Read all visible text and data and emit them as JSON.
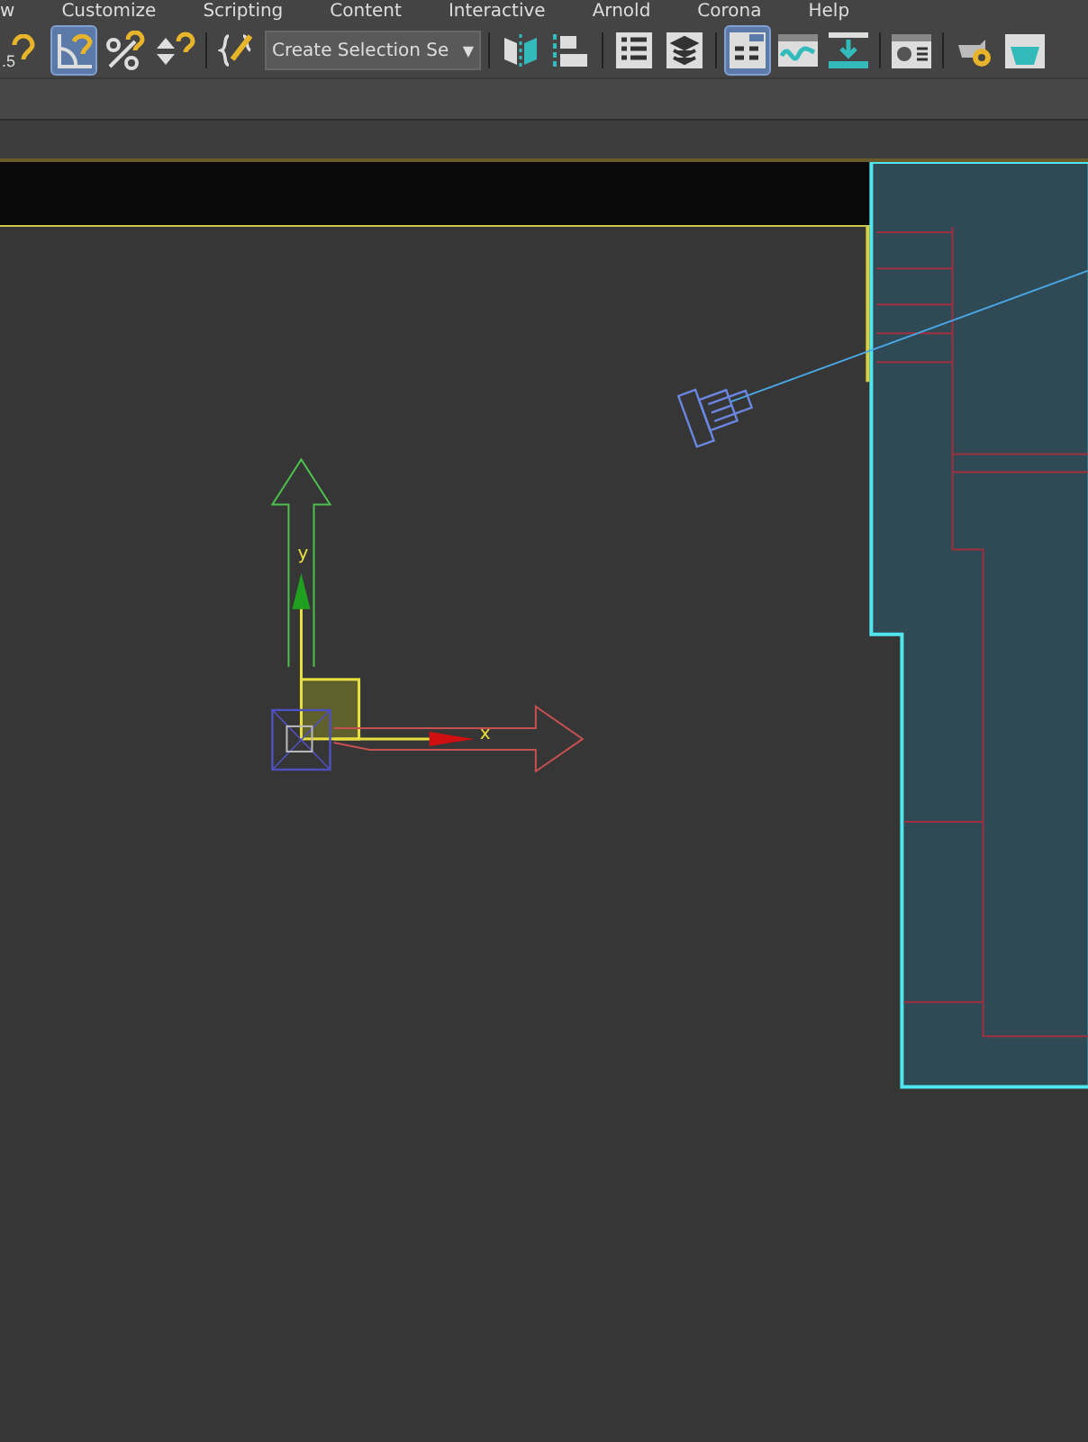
{
  "menu_bar": {
    "items": [
      "w",
      "Customize",
      "Scripting",
      "Content",
      "Interactive",
      "Arnold",
      "Corona",
      "Help"
    ]
  },
  "toolbar": {
    "items": [
      {
        "kind": "snap",
        "label": ".5",
        "active": false
      },
      {
        "kind": "angle-snap",
        "active": true
      },
      {
        "kind": "percent-snap",
        "active": false
      },
      {
        "kind": "spinner-snap",
        "active": false
      },
      {
        "kind": "separator"
      },
      {
        "kind": "edit-selection",
        "active": false
      },
      {
        "kind": "dropdown",
        "value": "Create Selection Se",
        "arrow": "▼"
      },
      {
        "kind": "separator"
      },
      {
        "kind": "mirror",
        "active": false
      },
      {
        "kind": "align",
        "active": false
      },
      {
        "kind": "separator"
      },
      {
        "kind": "list",
        "active": false
      },
      {
        "kind": "layers",
        "active": false
      },
      {
        "kind": "separator"
      },
      {
        "kind": "ribbon",
        "active": true
      },
      {
        "kind": "curve",
        "active": false
      },
      {
        "kind": "download",
        "active": false
      },
      {
        "kind": "separator"
      },
      {
        "kind": "material",
        "active": false
      },
      {
        "kind": "separator"
      },
      {
        "kind": "teapot",
        "active": false
      },
      {
        "kind": "frame",
        "active": false
      }
    ]
  },
  "viewport": {
    "axis_labels": [
      "y",
      "x"
    ]
  }
}
